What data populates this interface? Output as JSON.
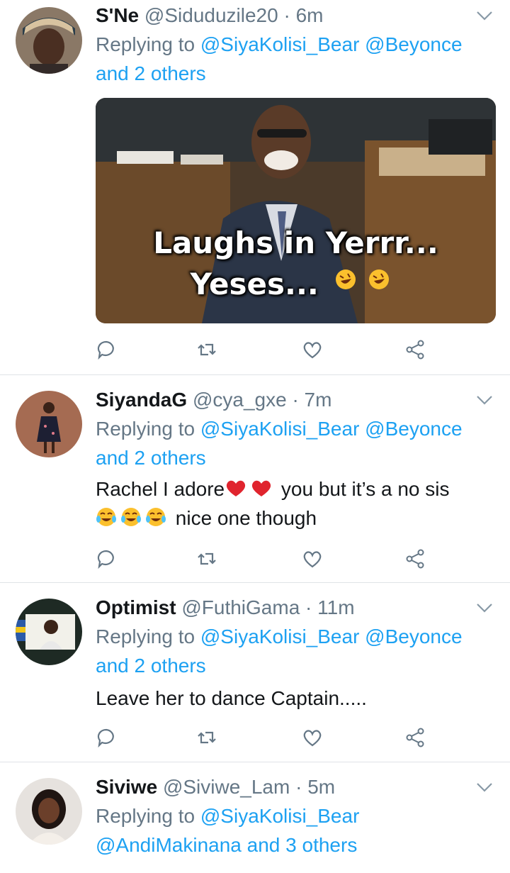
{
  "tweets": [
    {
      "name": "S'Ne",
      "handle": "@Siduduzile20",
      "time": "· 6m",
      "replying_prefix": "Replying to",
      "replying_line1": "@SiyaKolisi_Bear @Beyonce",
      "replying_line2": "and 2 others",
      "media_caption_line1": "Laughs in Yerrr...",
      "media_caption_line2": "Yeses..."
    },
    {
      "name": "SiyandaG",
      "handle": "@cya_gxe",
      "time": "· 7m",
      "replying_prefix": "Replying to",
      "replying_line1": "@SiyaKolisi_Bear @Beyonce",
      "replying_line2": "and 2 others",
      "text_part1": "Rachel I adore",
      "text_part2": "you but it’s a no sis",
      "text_part3": "nice one though"
    },
    {
      "name": "Optimist",
      "handle": "@FuthiGama",
      "time": "· 11m",
      "replying_prefix": "Replying to",
      "replying_line1": "@SiyaKolisi_Bear @Beyonce",
      "replying_line2": "and 2 others",
      "text": "Leave her to dance Captain....."
    },
    {
      "name": "Siviwe",
      "handle": "@Siviwe_Lam",
      "time": "· 5m",
      "replying_prefix": "Replying to",
      "replying_line1": "@SiyaKolisi_Bear",
      "replying_line2": "@AndiMakinana and 3 others"
    }
  ],
  "icons": [
    "reply-icon",
    "retweet-icon",
    "like-icon",
    "share-icon",
    "chevron-down-icon"
  ],
  "colors": {
    "link": "#1da1f2",
    "meta": "#657786",
    "text": "#14171a",
    "divider": "#dfe3e7"
  }
}
